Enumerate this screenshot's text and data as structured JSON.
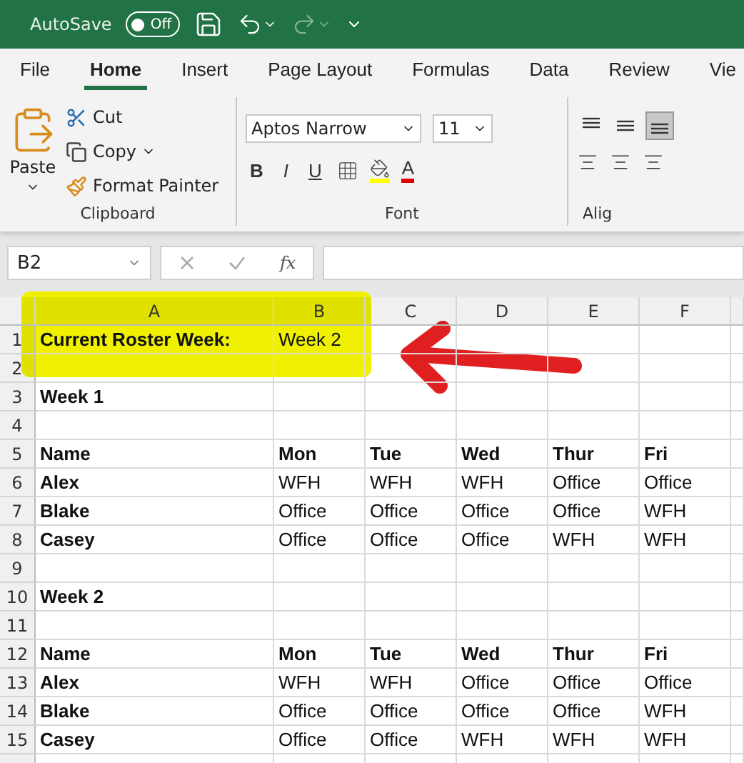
{
  "title_bar": {
    "autosave_label": "AutoSave",
    "autosave_on": false,
    "toggle_text": "Off"
  },
  "menu_tabs": [
    {
      "label": "File",
      "selected": false
    },
    {
      "label": "Home",
      "selected": true
    },
    {
      "label": "Insert",
      "selected": false
    },
    {
      "label": "Page Layout",
      "selected": false
    },
    {
      "label": "Formulas",
      "selected": false
    },
    {
      "label": "Data",
      "selected": false
    },
    {
      "label": "Review",
      "selected": false
    },
    {
      "label": "Vie",
      "selected": false
    }
  ],
  "ribbon": {
    "clipboard": {
      "paste": "Paste",
      "cut": "Cut",
      "copy": "Copy",
      "format_painter": "Format Painter",
      "label": "Clipboard"
    },
    "font": {
      "font_name": "Aptos Narrow",
      "font_size": "11",
      "bold": "B",
      "italic": "I",
      "underline": "U",
      "font_color": "A",
      "label": "Font"
    },
    "alignment": {
      "label": "Alig",
      "vertical": [
        {
          "kind": "top",
          "selected": false
        },
        {
          "kind": "middle",
          "selected": false
        },
        {
          "kind": "bottom",
          "selected": true
        }
      ]
    }
  },
  "formula_bar": {
    "name_box": "B2",
    "function_label": "fx"
  },
  "sheet": {
    "columns": [
      "A",
      "B",
      "C",
      "D",
      "E",
      "F"
    ],
    "rows": [
      {
        "number": "1",
        "kind": "setting",
        "cells": [
          "Current Roster Week:",
          "Week 2"
        ]
      },
      {
        "number": "2",
        "kind": "blank"
      },
      {
        "number": "3",
        "kind": "title",
        "cells": [
          "Week 1"
        ]
      },
      {
        "number": "4",
        "kind": "blank"
      },
      {
        "number": "5",
        "kind": "header",
        "cells": [
          "Name",
          "Mon",
          "Tue",
          "Wed",
          "Thur",
          "Fri"
        ]
      },
      {
        "number": "6",
        "kind": "data",
        "cells": [
          "Alex",
          "WFH",
          "WFH",
          "WFH",
          "Office",
          "Office"
        ]
      },
      {
        "number": "7",
        "kind": "data",
        "cells": [
          "Blake",
          "Office",
          "Office",
          "Office",
          "Office",
          "WFH"
        ]
      },
      {
        "number": "8",
        "kind": "data",
        "cells": [
          "Casey",
          "Office",
          "Office",
          "Office",
          "WFH",
          "WFH"
        ]
      },
      {
        "number": "9",
        "kind": "blank"
      },
      {
        "number": "10",
        "kind": "title",
        "cells": [
          "Week 2"
        ]
      },
      {
        "number": "11",
        "kind": "blank"
      },
      {
        "number": "12",
        "kind": "header",
        "cells": [
          "Name",
          "Mon",
          "Tue",
          "Wed",
          "Thur",
          "Fri"
        ]
      },
      {
        "number": "13",
        "kind": "data",
        "cells": [
          "Alex",
          "WFH",
          "WFH",
          "Office",
          "Office",
          "Office"
        ]
      },
      {
        "number": "14",
        "kind": "data",
        "cells": [
          "Blake",
          "Office",
          "Office",
          "Office",
          "Office",
          "WFH"
        ]
      },
      {
        "number": "15",
        "kind": "data",
        "cells": [
          "Casey",
          "Office",
          "Office",
          "WFH",
          "WFH",
          "WFH"
        ]
      }
    ]
  }
}
